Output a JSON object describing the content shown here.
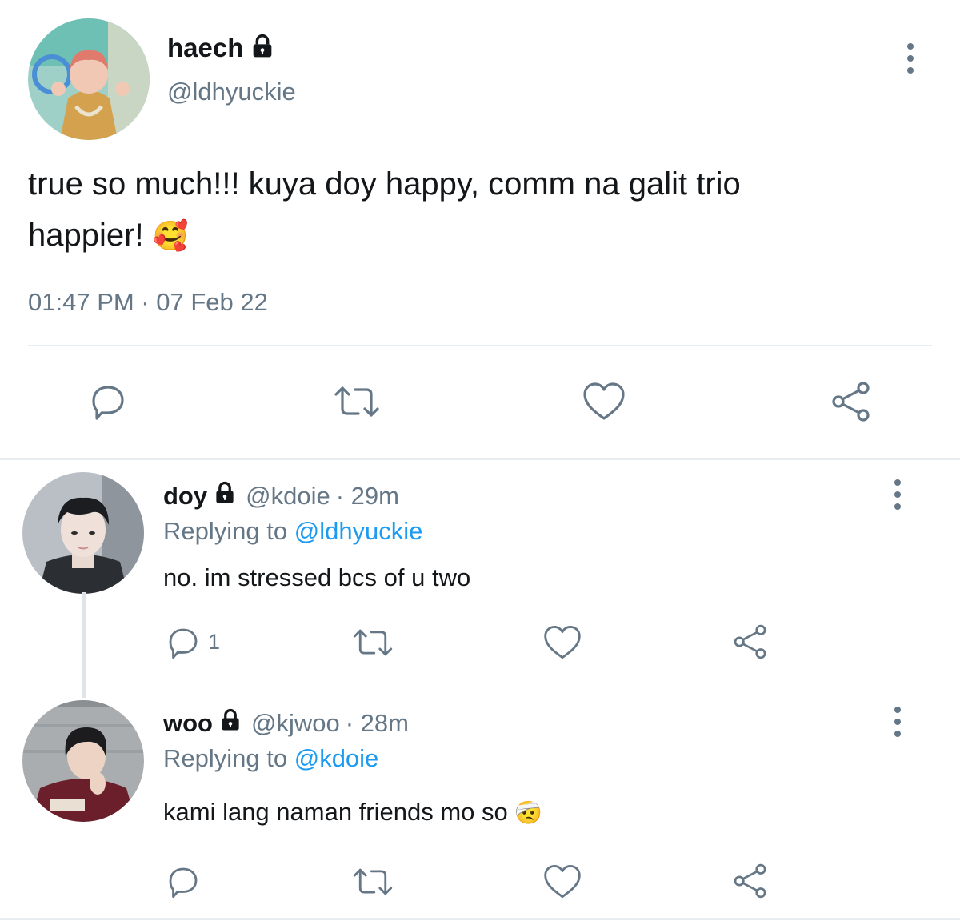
{
  "main_tweet": {
    "display_name": "haech",
    "handle": "@ldhyuckie",
    "text_line1": "true so much!!! kuya doy happy, comm na galit trio",
    "text_line2": "happier!",
    "emoji": "🥰",
    "timestamp": "01:47 PM · 07 Feb 22"
  },
  "replies": [
    {
      "display_name": "doy",
      "handle": "@kdoie",
      "time": "· 29m",
      "replying_label": "Replying to",
      "replying_to": "@ldhyuckie",
      "text": "no. im stressed bcs of u two",
      "emoji": "",
      "reply_count": "1"
    },
    {
      "display_name": "woo",
      "handle": "@kjwoo",
      "time": "· 28m",
      "replying_label": "Replying to",
      "replying_to": "@kdoie",
      "text": "kami lang naman friends mo so",
      "emoji": "🤕",
      "reply_count": ""
    }
  ],
  "icons": [
    "lock-icon",
    "more-icon",
    "reply-icon",
    "retweet-icon",
    "like-icon",
    "share-icon"
  ],
  "colors": {
    "text": "#14171a",
    "secondary": "#657786",
    "link": "#1d9bf0",
    "divider": "#e6ecf0"
  }
}
